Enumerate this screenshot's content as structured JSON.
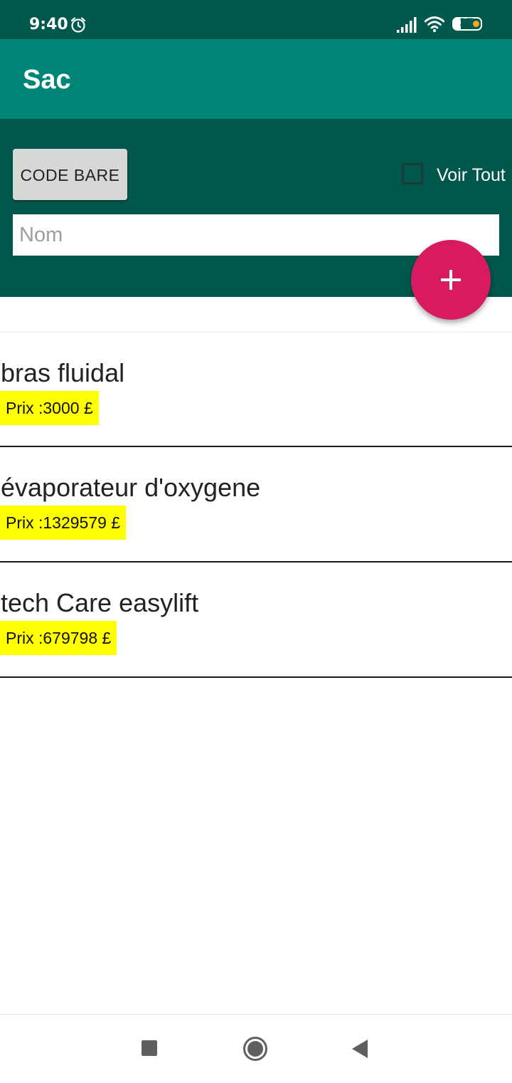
{
  "status_bar": {
    "time": "9:40",
    "battery": "27",
    "icons": [
      "alarm-icon",
      "signal-icon",
      "wifi-icon",
      "battery-icon"
    ],
    "battery_level": 0.27,
    "battery_dot_color": "#f5a623"
  },
  "app_bar": {
    "title": "Sac",
    "color": "#008577"
  },
  "controls": {
    "code_button_label": "CODE BARE",
    "voir_tout_label": "Voir Tout",
    "voir_tout_checked": false,
    "name_placeholder": "Nom",
    "name_value": "",
    "fab_icon": "plus-icon",
    "fab_color": "#d81b60"
  },
  "items": [
    {
      "name": "bras fluidal",
      "price": "Prix :3000 £"
    },
    {
      "name": "évaporateur d'oxygene",
      "price": "Prix :1329579 £"
    },
    {
      "name": "tech Care easylift",
      "price": "Prix :679798 £"
    }
  ],
  "price_highlight_color": "#ffff00",
  "nav_bar": {
    "icons": [
      "recents-icon",
      "home-icon",
      "back-icon"
    ]
  }
}
